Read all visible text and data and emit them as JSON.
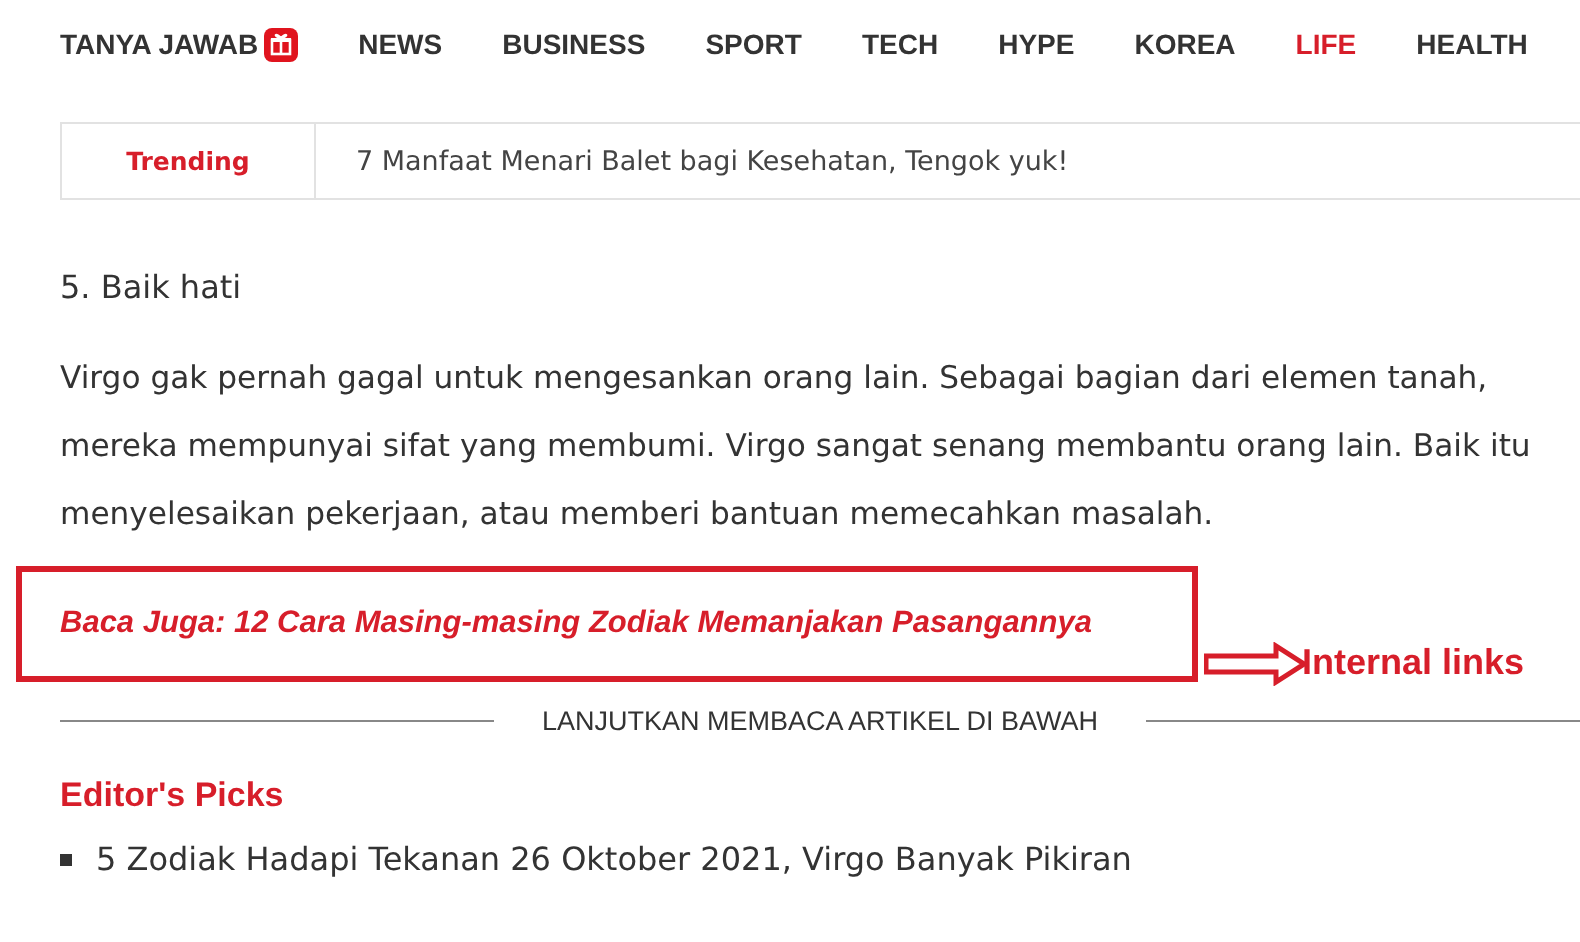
{
  "nav": {
    "items": [
      {
        "label": "TANYA JAWAB",
        "selected": false,
        "badge_icon": true
      },
      {
        "label": "NEWS",
        "selected": false
      },
      {
        "label": "BUSINESS",
        "selected": false
      },
      {
        "label": "SPORT",
        "selected": false
      },
      {
        "label": "TECH",
        "selected": false
      },
      {
        "label": "HYPE",
        "selected": false
      },
      {
        "label": "KOREA",
        "selected": false
      },
      {
        "label": "LIFE",
        "selected": true
      },
      {
        "label": "HEALTH",
        "selected": false
      }
    ]
  },
  "trending": {
    "label": "Trending",
    "headline": "7 Manfaat Menari Balet bagi Kesehatan, Tengok yuk!"
  },
  "article": {
    "heading": "5. Baik hati",
    "paragraph": "Virgo gak pernah gagal untuk mengesankan orang lain. Sebagai bagian dari elemen tanah, mereka mempunyai sifat yang membumi. Virgo sangat senang membantu orang lain. Baik itu menyelesaikan pekerjaan, atau memberi bantuan memecahkan masalah.",
    "related_link": "Baca Juga: 12 Cara Masing-masing Zodiak Memanjakan Pasangannya",
    "annotation": "Internal links",
    "divider_label": "LANJUTKAN MEMBACA ARTIKEL DI BAWAH"
  },
  "editors_picks": {
    "title": "Editor's Picks",
    "items": [
      "5 Zodiak Hadapi Tekanan 26 Oktober 2021, Virgo Banyak Pikiran"
    ]
  }
}
